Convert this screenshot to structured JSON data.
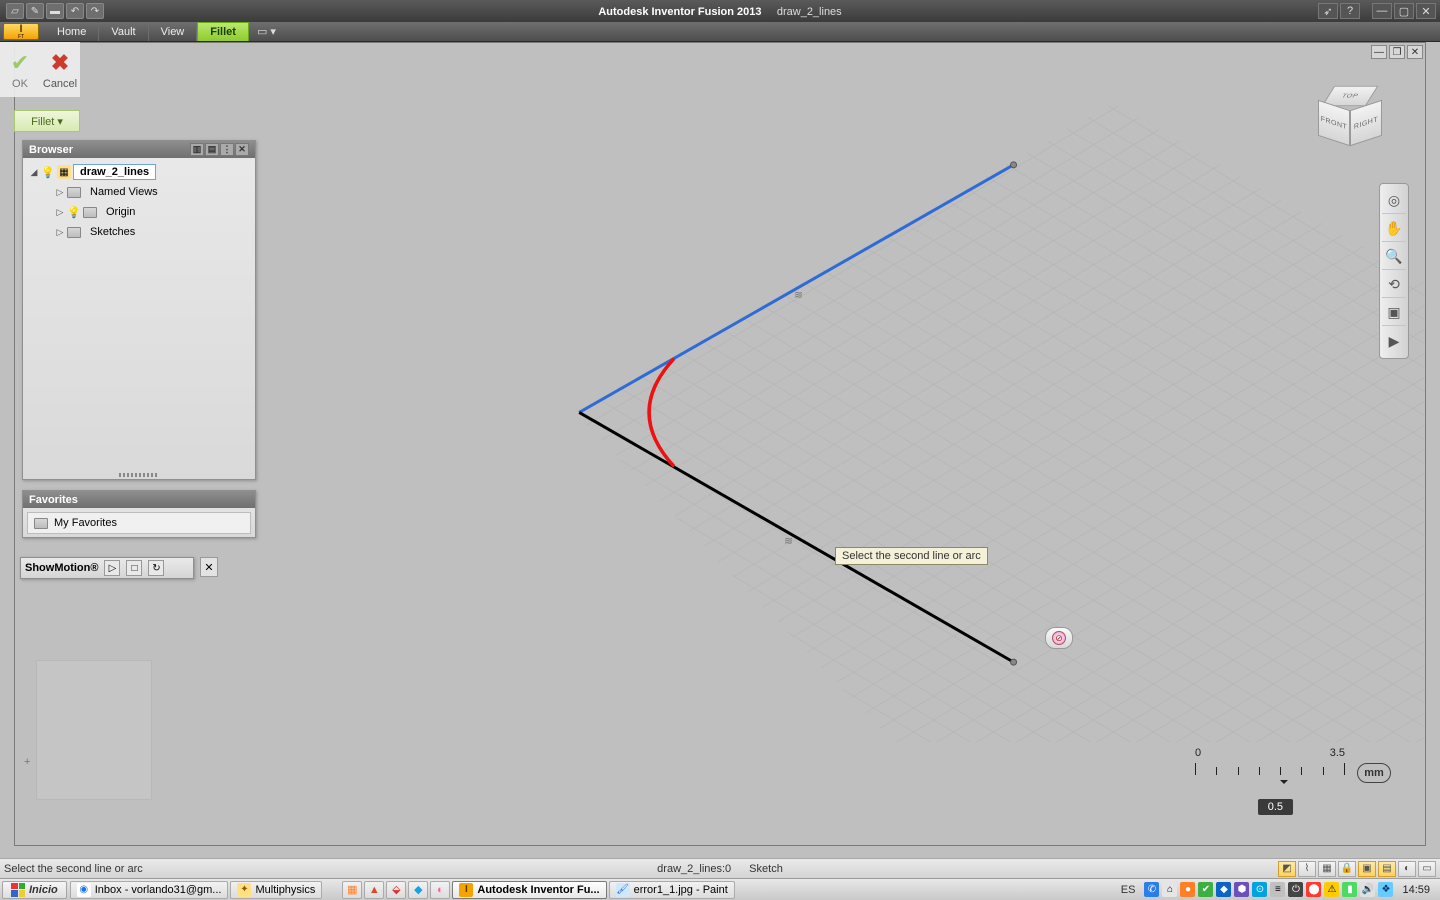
{
  "title": {
    "app": "Autodesk Inventor Fusion 2013",
    "doc": "draw_2_lines"
  },
  "ribbon": {
    "tabs": [
      "Home",
      "Vault",
      "View",
      "Fillet"
    ],
    "active": 3,
    "toggle": "▭ ▾"
  },
  "okcancel": {
    "ok": "OK",
    "cancel": "Cancel"
  },
  "fillet_dd": "Fillet ▾",
  "browser": {
    "title": "Browser",
    "root": "draw_2_lines",
    "children": [
      "Named Views",
      "Origin",
      "Sketches"
    ]
  },
  "favorites": {
    "title": "Favorites",
    "item": "My Favorites"
  },
  "showmotion": {
    "label": "ShowMotion®"
  },
  "tooltip": "Select the second line or arc",
  "viewcube": {
    "top": "TOP",
    "front": "FRONT",
    "right": "RIGHT"
  },
  "ruler": {
    "min": "0",
    "max": "3.5",
    "value": "0.5",
    "unit": "mm"
  },
  "status": {
    "prompt": "Select the second line or arc",
    "doc": "draw_2_lines:0",
    "mode": "Sketch"
  },
  "taskbar": {
    "start": "Inicio",
    "items": [
      {
        "label": "Inbox - vorlando31@gm...",
        "icon_bg": "#ffffff",
        "icon_fg": "#1a73e8",
        "glyph": "◉"
      },
      {
        "label": "Multiphysics",
        "icon_bg": "#ffe082",
        "icon_fg": "#8a5a00",
        "glyph": "✦"
      }
    ],
    "quick": [
      "▦",
      "▲",
      "⬙",
      "◆",
      "◐"
    ],
    "active": "Autodesk Inventor Fu...",
    "paint": "error1_1.jpg - Paint",
    "lang": "ES",
    "clock": "14:59"
  },
  "tray_icons": [
    {
      "bg": "#2b7de9",
      "glyph": "✆"
    },
    {
      "bg": "#e5e5e5",
      "glyph": "⌂"
    },
    {
      "bg": "#ff7f27",
      "glyph": "●"
    },
    {
      "bg": "#3cb043",
      "glyph": "✔"
    },
    {
      "bg": "#0a66c2",
      "glyph": "◆"
    },
    {
      "bg": "#6b4fbb",
      "glyph": "⬢"
    },
    {
      "bg": "#00a3e0",
      "glyph": "⊙"
    },
    {
      "bg": "#c0c0c0",
      "glyph": "≡"
    },
    {
      "bg": "#444",
      "glyph": "⏻"
    },
    {
      "bg": "#ff3b30",
      "glyph": "⬤"
    },
    {
      "bg": "#ffcc00",
      "glyph": "⚠"
    },
    {
      "bg": "#4cd964",
      "glyph": "▮"
    },
    {
      "bg": "#e0e0e0",
      "glyph": "🔊"
    },
    {
      "bg": "#66ccff",
      "glyph": "❖"
    }
  ]
}
